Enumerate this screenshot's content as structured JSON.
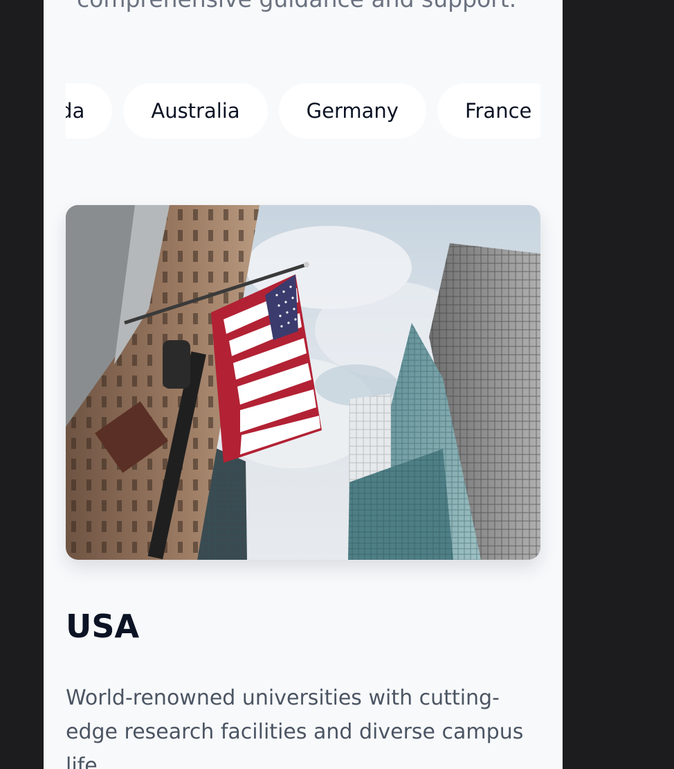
{
  "intro": {
    "text": "comprehensive guidance and support."
  },
  "country_tabs": [
    {
      "label": "Canada"
    },
    {
      "label": "Australia"
    },
    {
      "label": "Germany"
    },
    {
      "label": "France"
    }
  ],
  "card": {
    "title": "USA",
    "description": "World-renowned universities with cutting-edge research facilities and diverse campus life."
  }
}
